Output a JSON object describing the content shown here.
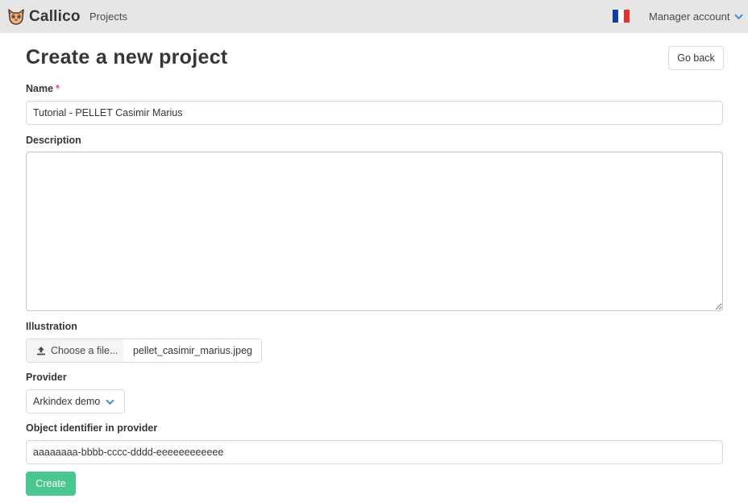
{
  "navbar": {
    "brand_name": "Callico",
    "projects_link": "Projects",
    "language_flag": "french-flag-icon",
    "account_label": "Manager account"
  },
  "page": {
    "title": "Create a new project",
    "go_back_label": "Go back"
  },
  "form": {
    "name_label": "Name",
    "required_marker": "*",
    "name_value": "Tutorial - PELLET Casimir Marius",
    "description_label": "Description",
    "description_value": "",
    "illustration_label": "Illustration",
    "choose_file_label": "Choose a file...",
    "file_name": "pellet_casimir_marius.jpeg",
    "provider_label": "Provider",
    "provider_selected": "Arkindex demo",
    "object_id_label": "Object identifier in provider",
    "object_id_value": "aaaaaaaa-bbbb-cccc-dddd-eeeeeeeeeeee",
    "create_label": "Create"
  },
  "colors": {
    "navbar_bg": "#e6e6e6",
    "primary_success": "#48c78e",
    "required": "#f14668",
    "accent_chevron": "#3e8ed0"
  }
}
